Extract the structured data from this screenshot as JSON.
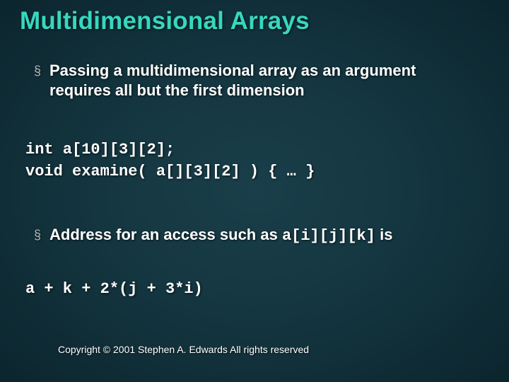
{
  "title": "Multidimensional Arrays",
  "bullets": [
    "Passing a multidimensional array as an argument requires all but the first dimension"
  ],
  "code_block1": "int a[10][3][2];\nvoid examine( a[][3][2] ) { … }",
  "bullets2": {
    "prefix": "Address for an access such as ",
    "code": "a[i][j][k]",
    "suffix": " is"
  },
  "code_block2": "a + k + 2*(j + 3*i)",
  "footer": "Copyright © 2001 Stephen A. Edwards  All rights reserved"
}
